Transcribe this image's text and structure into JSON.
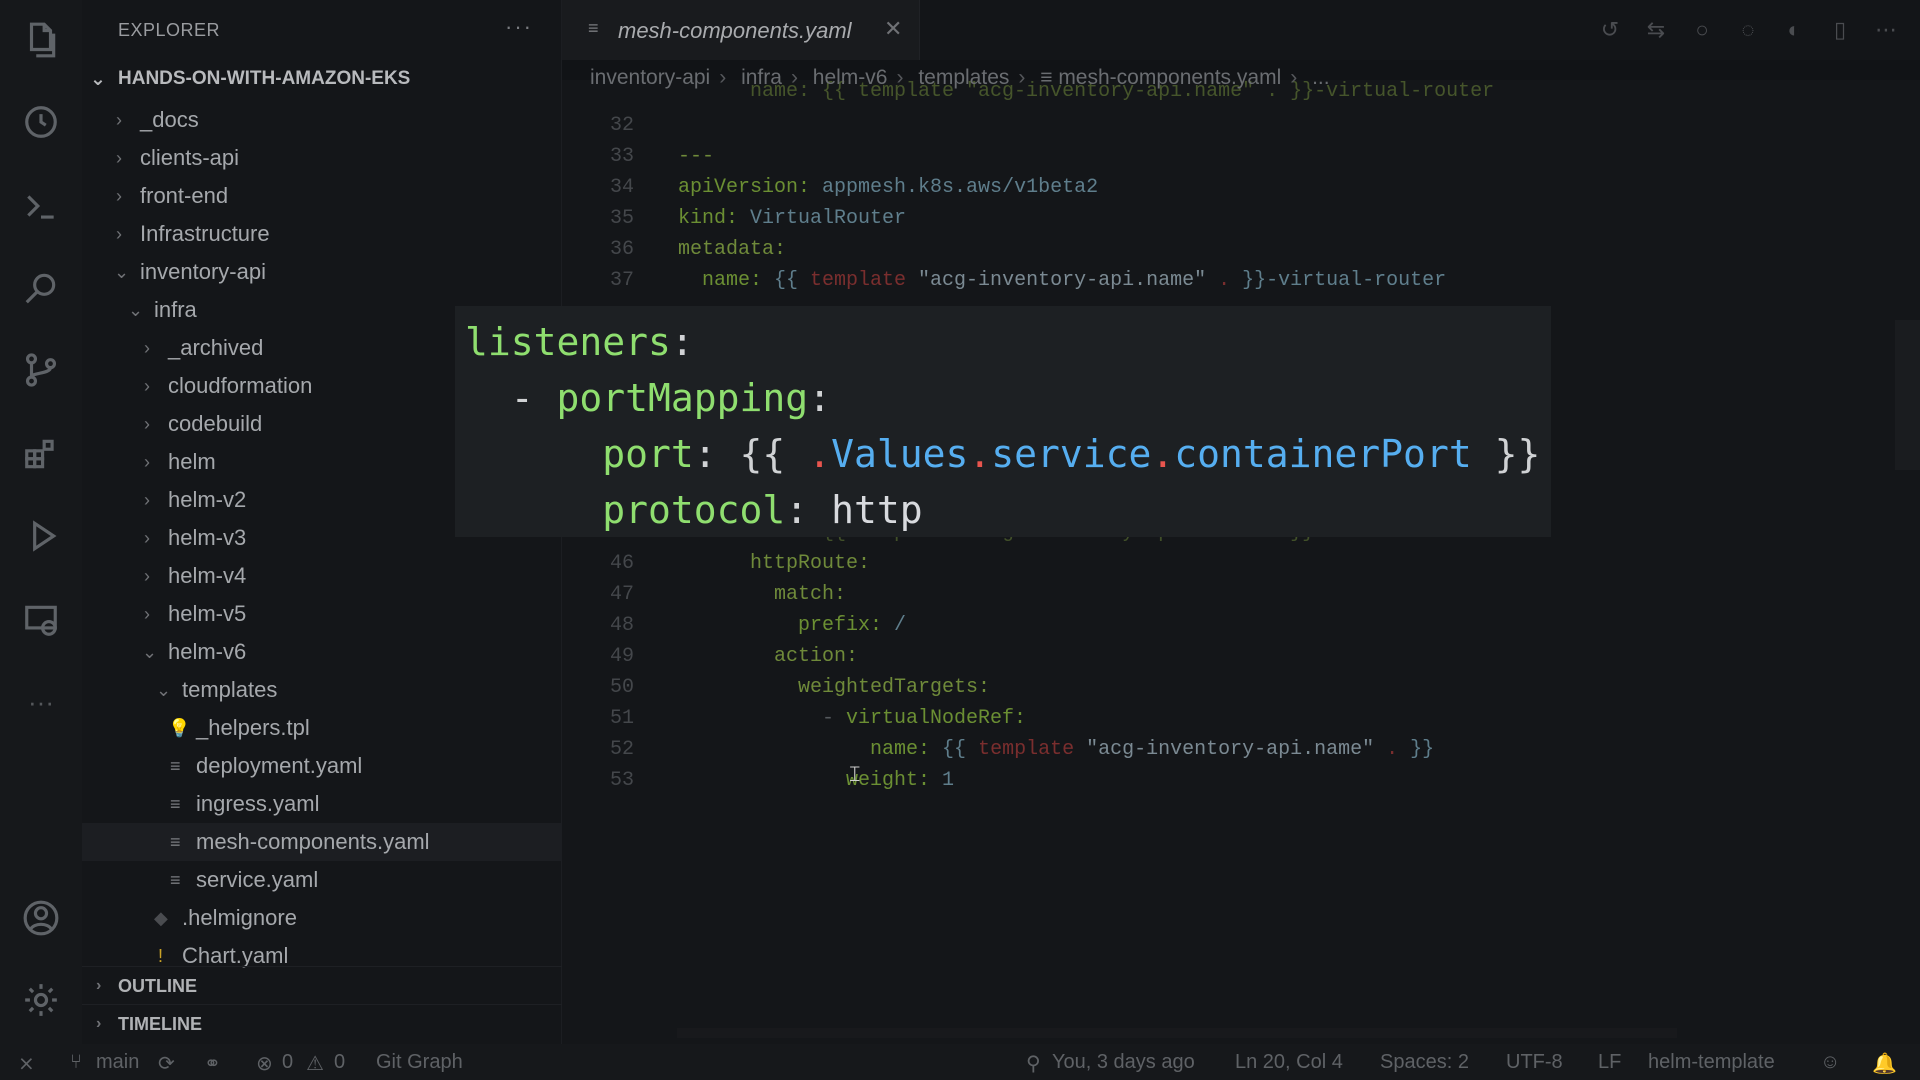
{
  "sidebar": {
    "title": "EXPLORER",
    "more": "···",
    "root": "HANDS-ON-WITH-AMAZON-EKS",
    "items": [
      {
        "label": "_docs",
        "kind": "folder",
        "open": false
      },
      {
        "label": "clients-api",
        "kind": "folder",
        "open": false
      },
      {
        "label": "front-end",
        "kind": "folder",
        "open": false
      },
      {
        "label": "Infrastructure",
        "kind": "folder",
        "open": false
      },
      {
        "label": "inventory-api",
        "kind": "folder",
        "open": true
      },
      {
        "label": "infra",
        "kind": "folder",
        "open": true
      },
      {
        "label": "_archived",
        "kind": "folder",
        "open": false
      },
      {
        "label": "cloudformation",
        "kind": "folder",
        "open": false
      },
      {
        "label": "codebuild",
        "kind": "folder",
        "open": false
      },
      {
        "label": "helm",
        "kind": "folder",
        "open": false
      },
      {
        "label": "helm-v2",
        "kind": "folder",
        "open": false
      },
      {
        "label": "helm-v3",
        "kind": "folder",
        "open": false
      },
      {
        "label": "helm-v4",
        "kind": "folder",
        "open": false
      },
      {
        "label": "helm-v5",
        "kind": "folder",
        "open": false
      },
      {
        "label": "helm-v6",
        "kind": "folder",
        "open": true
      },
      {
        "label": "templates",
        "kind": "folder",
        "open": true
      },
      {
        "label": "_helpers.tpl",
        "kind": "file"
      },
      {
        "label": "deployment.yaml",
        "kind": "file"
      },
      {
        "label": "ingress.yaml",
        "kind": "file"
      },
      {
        "label": "mesh-components.yaml",
        "kind": "file"
      },
      {
        "label": "service.yaml",
        "kind": "file"
      },
      {
        "label": ".helmignore",
        "kind": "file"
      },
      {
        "label": "Chart.yaml",
        "kind": "file"
      }
    ],
    "outline": "OUTLINE",
    "timeline": "TIMELINE"
  },
  "tab": {
    "name": "mesh-components.yaml",
    "close": "✕"
  },
  "breadcrumb": [
    "inventory-api",
    "infra",
    "helm-v6",
    "templates",
    "mesh-components.yaml",
    "..."
  ],
  "code_lines": [
    {
      "n": "32"
    },
    {
      "n": "33"
    },
    {
      "n": "34"
    },
    {
      "n": "35"
    },
    {
      "n": "36"
    },
    {
      "n": "37"
    },
    {
      "n": "46"
    },
    {
      "n": "47"
    },
    {
      "n": "48"
    },
    {
      "n": "49"
    },
    {
      "n": "50"
    },
    {
      "n": "51"
    },
    {
      "n": "52"
    },
    {
      "n": "53"
    }
  ],
  "code": {
    "l31": "      name: {{ template \"acg-inventory-api.name\" . }}-virtual-router",
    "l33": "---",
    "l34_k": "apiVersion:",
    "l34_v": " appmesh.k8s.aws/v1beta2",
    "l35_k": "kind:",
    "l35_v": " VirtualRouter",
    "l36_k": "metadata:",
    "l37_k": "  name:",
    "l37_a": " {{ ",
    "l37_t": "template",
    "l37_s": " \"acg-inventory-api.name\"",
    "l37_p": " . ",
    "l37_b": "}}-virtual-router",
    "l45": "      name: {{ template \"acg-inventory-api.name\" . }}-route",
    "l46": "      httpRoute:",
    "l47": "        match:",
    "l48_k": "          prefix:",
    "l48_v": " /",
    "l49": "        action:",
    "l50": "          weightedTargets:",
    "l51_d": "            - ",
    "l51_k": "virtualNodeRef:",
    "l52_k": "                name:",
    "l52_a": " {{ ",
    "l52_t": "template",
    "l52_s": " \"acg-inventory-api.name\"",
    "l52_p": " . ",
    "l52_b": "}}",
    "l53_k": "              weight:",
    "l53_v": " 1"
  },
  "overlay": {
    "l1_k": "listeners",
    "l1_c": ":",
    "l2_d": "  - ",
    "l2_k": "portMapping",
    "l2_c": ":",
    "l3_k": "      port",
    "l3_c": ": {{ ",
    "l3_d1": ".",
    "l3_v1": "Values",
    "l3_d2": ".",
    "l3_v2": "service",
    "l3_d3": ".",
    "l3_v3": "containerPort",
    "l3_e": " }}",
    "l4_k": "      protocol",
    "l4_c": ": ",
    "l4_v": "http"
  },
  "status": {
    "branch": "main",
    "errors": "0",
    "warnings": "0",
    "git_graph": "Git Graph",
    "blame": "You, 3 days ago",
    "position": "Ln 20, Col 4",
    "spaces": "Spaces: 2",
    "encoding": "UTF-8",
    "eol": "LF",
    "language": "helm-template"
  },
  "icons": [
    "files-icon",
    "timeline-icon",
    "terminal-icon",
    "search-icon",
    "source-control-icon",
    "extensions-icon",
    "run-debug-icon",
    "remote-explorer-icon",
    "more-icon",
    "account-icon",
    "settings-icon"
  ]
}
